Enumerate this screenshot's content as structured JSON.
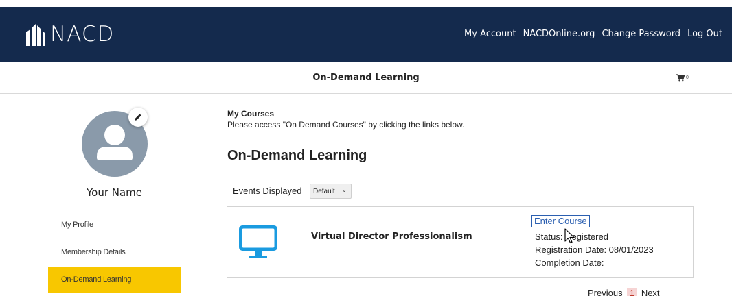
{
  "header": {
    "logo_text": "NACD",
    "nav": [
      "My Account",
      "NACDOnline.org",
      "Change Password",
      "Log Out"
    ]
  },
  "subheader": {
    "title": "On-Demand Learning",
    "cart_count": "0"
  },
  "profile": {
    "name": "Your Name"
  },
  "sidebar": {
    "items": [
      {
        "label": "My Profile",
        "active": false
      },
      {
        "label": "Membership Details",
        "active": false
      },
      {
        "label": "On-Demand Learning",
        "active": true
      }
    ]
  },
  "main": {
    "my_courses_heading": "My Courses",
    "instructions": "Please access \"On Demand Courses\" by clicking the links below.",
    "section_title": "On-Demand Learning",
    "events_label": "Events Displayed",
    "events_select_value": "Default"
  },
  "course": {
    "title": "Virtual Director Professionalism",
    "enter_label": "Enter Course",
    "status": "Status: Registered",
    "registration_date": "Registration Date: 08/01/2023",
    "completion_date": "Completion Date:"
  },
  "pagination": {
    "previous": "Previous",
    "current_page": "1",
    "next": "Next"
  },
  "colors": {
    "header_bg": "#142a4d",
    "active_sidebar": "#f8c700",
    "monitor_icon": "#1a9be0",
    "link": "#2b5fb0"
  },
  "icons": [
    "nacd-logo-icon",
    "cart-icon",
    "user-avatar-icon",
    "pencil-icon",
    "monitor-icon",
    "mouse-cursor-icon",
    "chevron-down-icon"
  ]
}
